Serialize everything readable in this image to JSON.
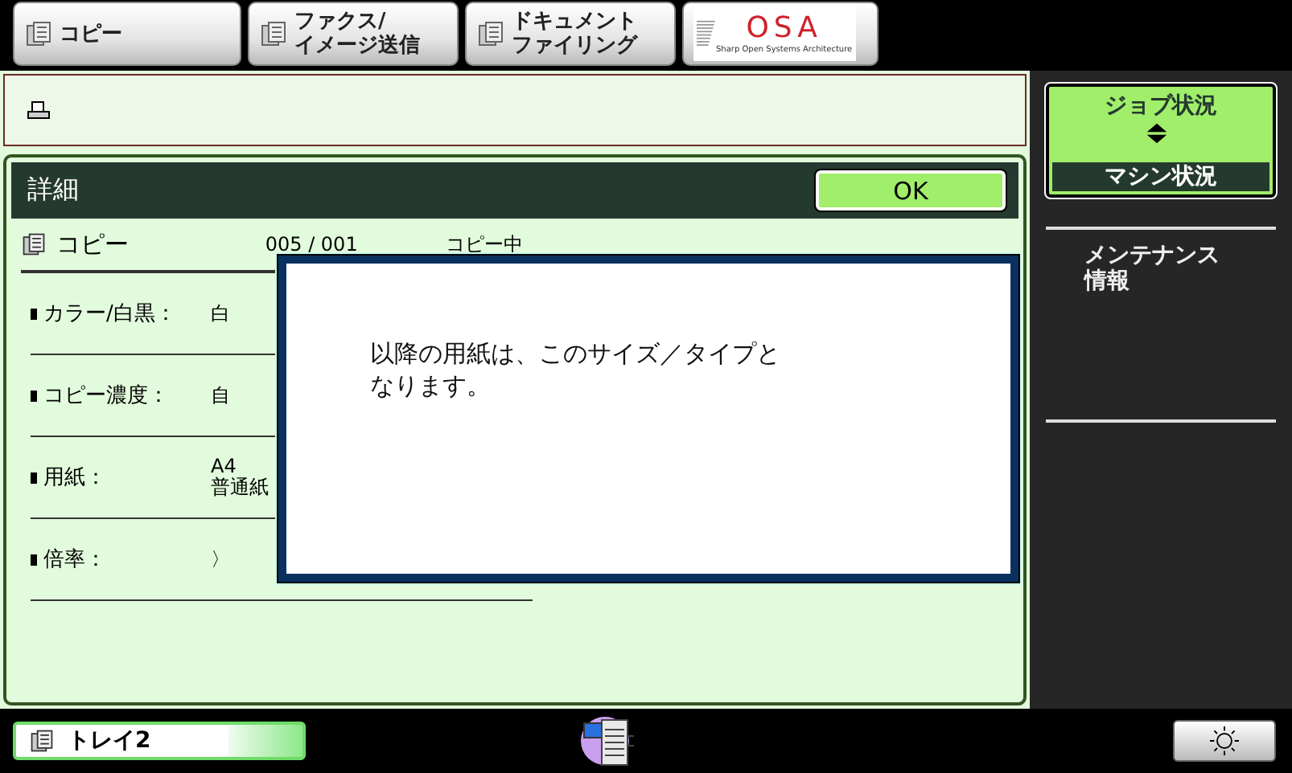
{
  "mode_tabs": [
    {
      "lines": [
        "コピー"
      ],
      "kind": "text"
    },
    {
      "lines": [
        "ファクス/",
        "イメージ送信"
      ],
      "kind": "text"
    },
    {
      "lines": [
        "ドキュメント",
        "ファイリング"
      ],
      "kind": "text"
    },
    {
      "label": "OSA",
      "sublabel": "Sharp Open Systems Architecture",
      "kind": "logo"
    }
  ],
  "detail": {
    "title": "詳細",
    "ok": "OK",
    "job": {
      "name": "コピー",
      "count": "005 / 001",
      "status": "コピー中"
    },
    "rows": [
      {
        "label": "カラー/白黒：",
        "value": [
          "白"
        ]
      },
      {
        "label": "コピー濃度：",
        "value": [
          "自"
        ]
      },
      {
        "label": "用紙：",
        "value": [
          "A4",
          "普通紙"
        ]
      },
      {
        "label": "倍率：",
        "value": [
          "〉"
        ]
      }
    ]
  },
  "dialog": {
    "message": [
      "以降の用紙は、このサイズ／タイプと",
      "なります。"
    ]
  },
  "status_toggle": {
    "options": [
      {
        "label": "ジョブ状況",
        "selected": true
      },
      {
        "label": "マシン状況",
        "selected": false
      }
    ]
  },
  "side_items": [
    {
      "lines": [
        "メンテナンス",
        "情報"
      ]
    }
  ],
  "tray": {
    "label": "トレイ2"
  }
}
